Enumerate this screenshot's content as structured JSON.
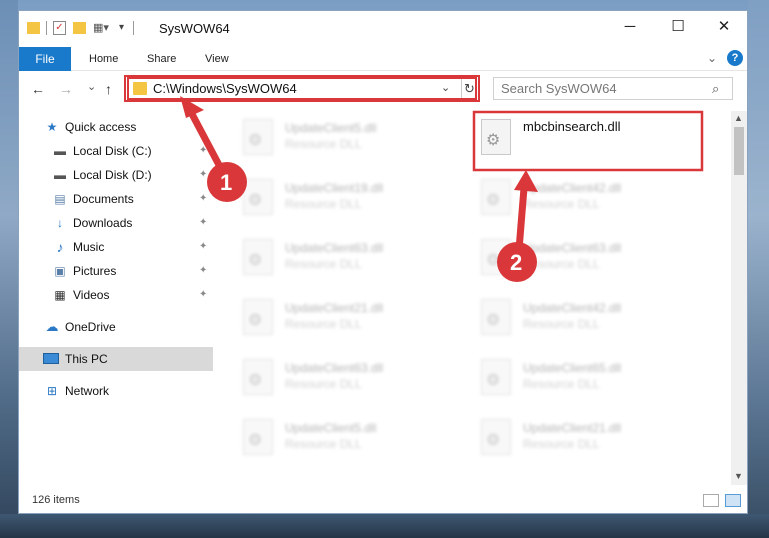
{
  "window": {
    "title": "SysWOW64",
    "minimize_glyph": "─",
    "maximize_glyph": "☐",
    "close_glyph": "✕"
  },
  "ribbon": {
    "file_tab": "File",
    "tabs": [
      "Home",
      "Share",
      "View"
    ],
    "help_glyph": "?"
  },
  "navigation": {
    "back_glyph": "←",
    "forward_glyph": "→",
    "recent_glyph": "⌄",
    "up_glyph": "↑"
  },
  "address_bar": {
    "path": "C:\\Windows\\SysWOW64",
    "chevron_glyph": "⌄",
    "refresh_glyph": "↻"
  },
  "search": {
    "placeholder": "Search SysWOW64",
    "icon_glyph": "⌕"
  },
  "sidebar": {
    "items": [
      {
        "label": "Quick access",
        "icon": "star-icon",
        "glyph": "★",
        "color": "#2b78c5",
        "pinned": false
      },
      {
        "label": "Local Disk (C:)",
        "icon": "drive-icon",
        "glyph": "▬",
        "color": "#555555",
        "pinned": true
      },
      {
        "label": "Local Disk (D:)",
        "icon": "drive-icon",
        "glyph": "▬",
        "color": "#555555",
        "pinned": true
      },
      {
        "label": "Documents",
        "icon": "documents-icon",
        "glyph": "▤",
        "color": "#5a7fa8",
        "pinned": true
      },
      {
        "label": "Downloads",
        "icon": "download-icon",
        "glyph": "↓",
        "color": "#2b78c5",
        "pinned": true
      },
      {
        "label": "Music",
        "icon": "music-icon",
        "glyph": "♪",
        "color": "#2b78c5",
        "pinned": true
      },
      {
        "label": "Pictures",
        "icon": "pictures-icon",
        "glyph": "▣",
        "color": "#5a7fa8",
        "pinned": true
      },
      {
        "label": "Videos",
        "icon": "videos-icon",
        "glyph": "▦",
        "color": "#333333",
        "pinned": true
      },
      {
        "label": "OneDrive",
        "icon": "cloud-icon",
        "glyph": "☁",
        "color": "#2b78c5",
        "pinned": false
      },
      {
        "label": "This PC",
        "icon": "computer-icon",
        "glyph": "▭",
        "color": "#2b78c5",
        "pinned": false
      },
      {
        "label": "Network",
        "icon": "network-icon",
        "glyph": "⊞",
        "color": "#2b78c5",
        "pinned": false
      }
    ],
    "pin_glyph": "✦"
  },
  "files": {
    "left_column": [
      {
        "name": "UpdateClient5.dll",
        "type": "Resource DLL"
      },
      {
        "name": "UpdateClient19.dll",
        "type": "Resource DLL"
      },
      {
        "name": "UpdateClient63.dll",
        "type": "Resource DLL"
      },
      {
        "name": "UpdateClient21.dll",
        "type": "Resource DLL"
      },
      {
        "name": "UpdateClient63.dll",
        "type": "Resource DLL"
      },
      {
        "name": "UpdateClient5.dll",
        "type": "Resource DLL"
      }
    ],
    "right_column": [
      {
        "name": "mbcbinsearch.dll",
        "type": ""
      },
      {
        "name": "UpdateClient42.dll",
        "type": "Resource DLL"
      },
      {
        "name": "UpdateClient63.dll",
        "type": "Resource DLL"
      },
      {
        "name": "UpdateClient42.dll",
        "type": "Resource DLL"
      },
      {
        "name": "UpdateClient65.dll",
        "type": "Resource DLL"
      },
      {
        "name": "UpdateClient21.dll",
        "type": "Resource DLL"
      }
    ],
    "gear_glyph": "⚙"
  },
  "status": {
    "item_count": "126 items"
  },
  "annotations": {
    "callout_1": "1",
    "callout_2": "2",
    "accent_color": "#d9373a"
  }
}
